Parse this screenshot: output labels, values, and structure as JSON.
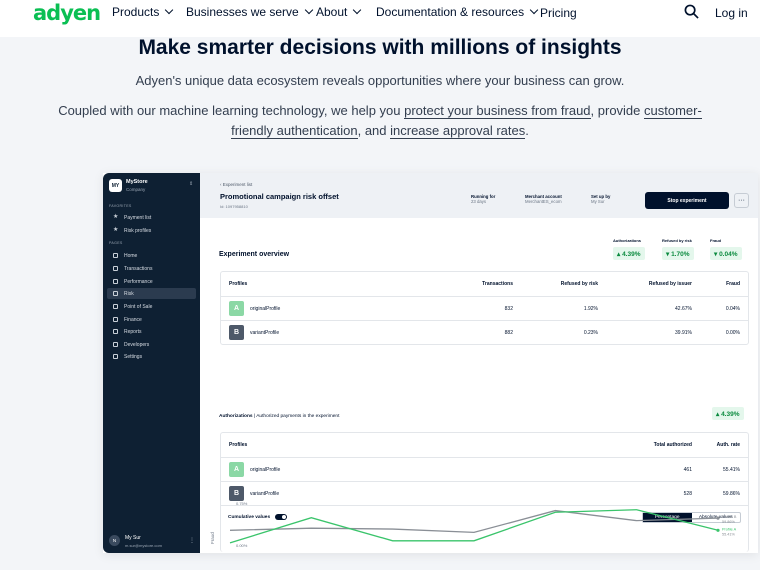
{
  "nav": {
    "logo": "adyen",
    "items": [
      "Products",
      "Businesses we serve",
      "About",
      "Documentation & resources"
    ],
    "pricing": "Pricing",
    "login": "Log in"
  },
  "hero": {
    "title": "Make smarter decisions with millions of insights",
    "subtitle": "Adyen's unique data ecosystem reveals opportunities where your business can grow.",
    "p_before": "Coupled with our machine learning technology, we help you ",
    "link1": "protect your business from fraud",
    "p_mid1": ", provide ",
    "link2": "customer-friendly authentication",
    "p_mid2": ", and ",
    "link3": "increase approval rates",
    "p_end": "."
  },
  "sidebar": {
    "store_logo": "MY",
    "store_name": "MyStore",
    "store_type": "Company",
    "sec_fav": "FAVORITES",
    "sec_pages": "PAGES",
    "favorites": [
      "Payment list",
      "Risk profiles"
    ],
    "pages": [
      "Home",
      "Transactions",
      "Performance",
      "Risk",
      "Point of Sale",
      "Finance",
      "Reports",
      "Developers",
      "Settings"
    ],
    "user_initial": "N",
    "user_name": "My Sur",
    "user_mail": "m.sur@mystore.com"
  },
  "header": {
    "breadcrumb": "‹ Experiment list",
    "title": "Promotional campaign risk offset",
    "id": "Id: 1097958810",
    "running_label": "Running for",
    "running_value": "23 days",
    "merchant_label": "Merchant account",
    "merchant_value": "MerchantES_ecom",
    "setup_label": "Set up by",
    "setup_value": "My Sur",
    "stop": "Stop experiment",
    "more": "···"
  },
  "overview": {
    "title": "Experiment overview",
    "kpis": [
      {
        "label": "Authorizations",
        "value": "▴ 4.39%"
      },
      {
        "label": "Refused by risk",
        "value": "▾ 1.70%"
      },
      {
        "label": "Fraud",
        "value": "▾ 0.04%"
      }
    ],
    "headers": [
      "Profiles",
      "Transactions",
      "Refused by risk",
      "Refused by issuer",
      "Fraud"
    ],
    "rows": [
      {
        "badge": "A",
        "name": "originalProfile",
        "tx": "832",
        "risk": "1.92%",
        "issuer": "42.67%",
        "fraud": "0.04%"
      },
      {
        "badge": "B",
        "name": "variantProfile",
        "tx": "882",
        "risk": "0.23%",
        "issuer": "39.91%",
        "fraud": "0.00%"
      }
    ]
  },
  "auth": {
    "title": "Authorizations",
    "sub": " | Authorized payments in the experiment",
    "kpi": "▴ 4.39%",
    "headers": [
      "Profiles",
      "Total authorized",
      "Auth. rate"
    ],
    "rows": [
      {
        "badge": "A",
        "name": "originalProfile",
        "total": "461",
        "rate": "55.41%"
      },
      {
        "badge": "B",
        "name": "variantProfile",
        "total": "528",
        "rate": "59.86%"
      }
    ],
    "cumulative": "Cumulative values",
    "seg": [
      "Percentage",
      "Absolute values"
    ]
  },
  "chart_data": {
    "type": "line",
    "ylabel": "Fraud",
    "ytick_labels": [
      "0.75%",
      "0.00%"
    ],
    "series": [
      {
        "name": "Profile B",
        "end_label": "59.86%",
        "color": "#8a8f96",
        "values": [
          0.35,
          0.4,
          0.38,
          0.3,
          0.82,
          0.58,
          0.64
        ]
      },
      {
        "name": "Profile A",
        "end_label": "55.41%",
        "color": "#3ac46b",
        "values": [
          0.05,
          0.65,
          0.1,
          0.1,
          0.78,
          0.84,
          0.35
        ]
      }
    ]
  },
  "colors": {
    "brand": "#0abf53",
    "dark": "#00112c"
  }
}
